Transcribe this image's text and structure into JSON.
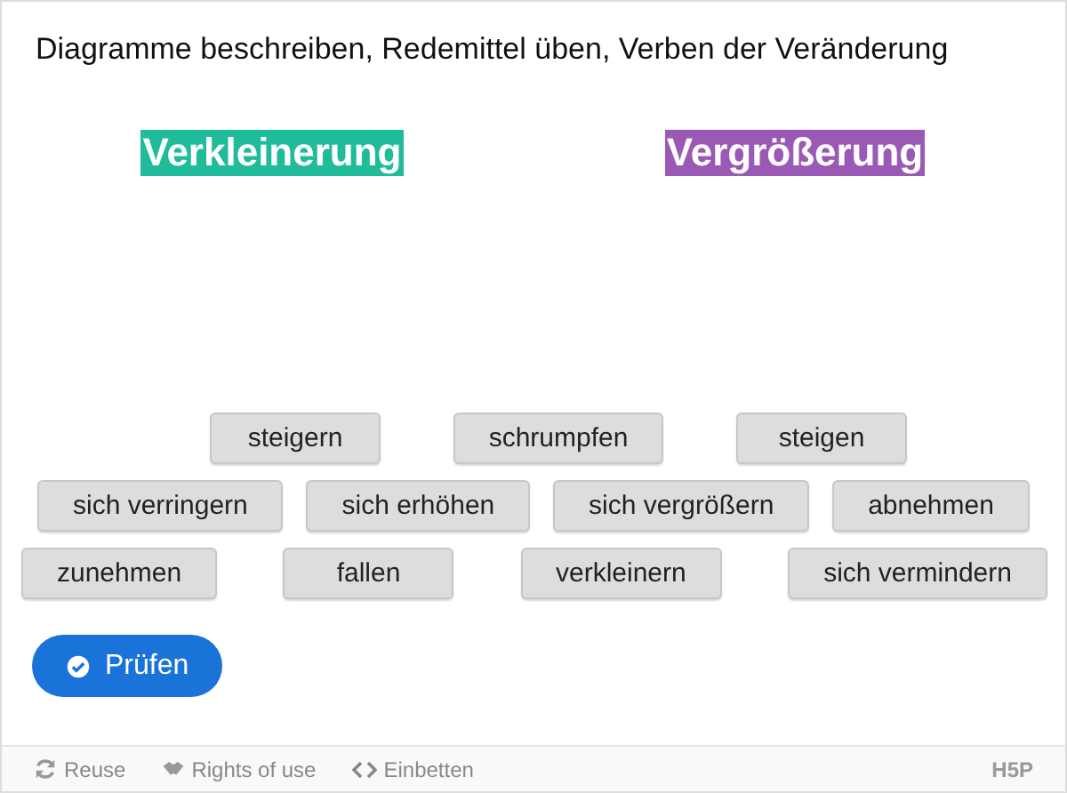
{
  "title": "Diagramme beschreiben, Redemittel üben, Verben der Veränderung",
  "categories": [
    {
      "label": "Verkleinerung",
      "color": "#1fbb9a"
    },
    {
      "label": "Vergrößerung",
      "color": "#9b59b6"
    }
  ],
  "word_rows": [
    [
      "steigern",
      "schrumpfen",
      "steigen"
    ],
    [
      "sich verringern",
      "sich erhöhen",
      "sich vergrößern",
      "abnehmen"
    ],
    [
      "zunehmen",
      "fallen",
      "verkleinern",
      "sich vermindern"
    ]
  ],
  "check_button": "Prüfen",
  "footer": {
    "links": [
      {
        "label": "Reuse",
        "kind": "reuse"
      },
      {
        "label": "Rights of use",
        "kind": "rights"
      },
      {
        "label": "Einbetten",
        "kind": "embed"
      }
    ],
    "logo": "H5P"
  }
}
